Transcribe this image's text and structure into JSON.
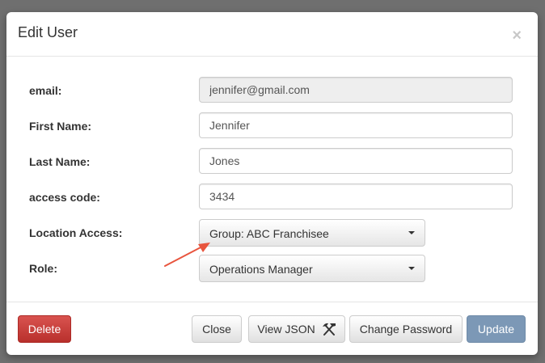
{
  "modal": {
    "title": "Edit User",
    "close_symbol": "×"
  },
  "form": {
    "email": {
      "label": "email:",
      "value": "jennifer@gmail.com"
    },
    "first_name": {
      "label": "First Name:",
      "value": "Jennifer"
    },
    "last_name": {
      "label": "Last Name:",
      "value": "Jones"
    },
    "access_code": {
      "label": "access code:",
      "value": "3434"
    },
    "location_access": {
      "label": "Location Access:",
      "selected": "Group: ABC Franchisee"
    },
    "role": {
      "label": "Role:",
      "selected": "Operations Manager"
    }
  },
  "footer": {
    "delete_label": "Delete",
    "close_label": "Close",
    "view_json_label": "View JSON",
    "change_password_label": "Change Password",
    "update_label": "Update"
  },
  "icons": {
    "close": "close-icon",
    "caret": "chevron-down-icon",
    "tools": "hammer-pick-icon",
    "annotation_arrow": "arrow-icon"
  },
  "colors": {
    "delete": "#d9534f",
    "update": "#7c98b6",
    "annotation_arrow": "#e8553e"
  }
}
